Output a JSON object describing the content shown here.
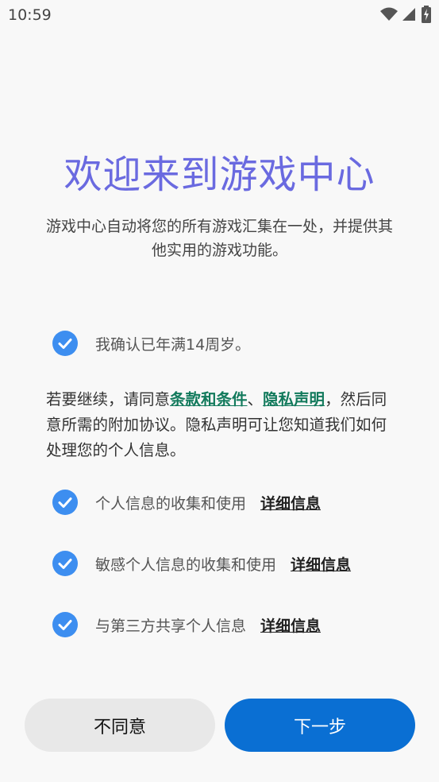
{
  "status": {
    "time": "10:59"
  },
  "header": {
    "title": "欢迎来到游戏中心",
    "intro": "游戏中心自动将您的所有游戏汇集在一处，并提供其他实用的游戏功能。"
  },
  "age_check": {
    "label": "我确认已年满14周岁。",
    "checked": true
  },
  "terms": {
    "prefix": "若要继续，请同意",
    "link_terms": "条款和条件",
    "sep": "、",
    "link_privacy": "隐私声明",
    "suffix": "，然后同意所需的附加协议。隐私声明可让您知道我们如何处理您的个人信息。"
  },
  "agreements": [
    {
      "label": "个人信息的收集和使用",
      "detail": "详细信息",
      "checked": true
    },
    {
      "label": "敏感个人信息的收集和使用",
      "detail": "详细信息",
      "checked": true
    },
    {
      "label": "与第三方共享个人信息",
      "detail": "详细信息",
      "checked": true
    }
  ],
  "buttons": {
    "disagree": "不同意",
    "next": "下一步"
  },
  "colors": {
    "accent": "#0a6fd3",
    "title": "#6a6ae0",
    "check": "#3d8ef0",
    "link": "#127a5c"
  },
  "icons": {
    "check": "checkmark-circle-icon",
    "wifi": "wifi-icon",
    "signal": "signal-icon",
    "battery": "battery-charging-icon"
  }
}
